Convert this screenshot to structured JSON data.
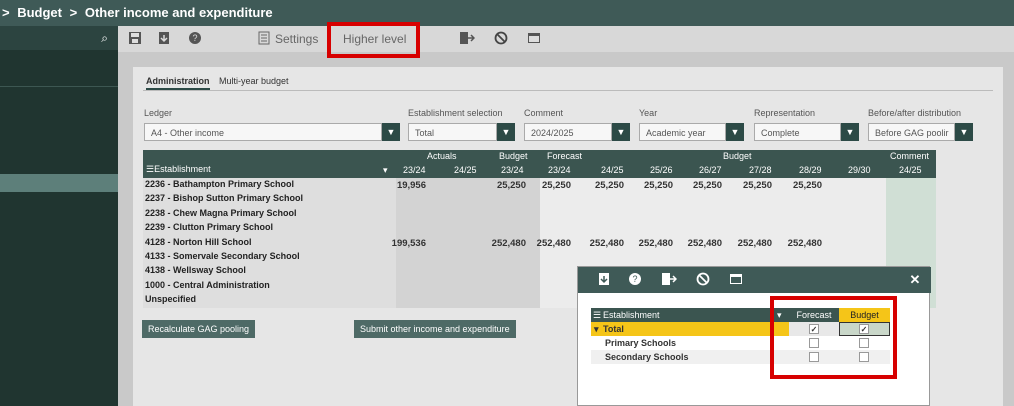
{
  "header": {
    "chevron": ">",
    "crumb1": "Budget",
    "chevron2": ">",
    "crumb2": "Other income and expenditure"
  },
  "sidebar": {
    "search_icon": "search-icon"
  },
  "toolbar": {
    "settings_label": "Settings",
    "higher_level_label": "Higher level"
  },
  "tabs": {
    "administration": "Administration",
    "multiyear": "Multi-year budget"
  },
  "filters": {
    "ledger_label": "Ledger",
    "ledger_value": "A4 - Other income",
    "establishment_label": "Establishment selection",
    "establishment_value": "Total",
    "comment_label": "Comment",
    "comment_value": "2024/2025",
    "year_label": "Year",
    "year_value": "Academic year",
    "representation_label": "Representation",
    "representation_value": "Complete",
    "before_after_label": "Before/after distribution",
    "before_after_value": "Before GAG poolir"
  },
  "table": {
    "establishment_header": "Establishment",
    "groups": {
      "actuals": "Actuals",
      "budget1": "Budget",
      "forecast": "Forecast",
      "budget2": "Budget",
      "comment": "Comment"
    },
    "years": [
      "23/24",
      "24/25",
      "23/24",
      "23/24",
      "24/25",
      "25/26",
      "26/27",
      "27/28",
      "28/29",
      "29/30",
      "24/25"
    ],
    "rows": [
      {
        "name": "2236 - Bathampton Primary School",
        "v": [
          "19,956",
          "",
          "25,250",
          "25,250",
          "25,250",
          "25,250",
          "25,250",
          "25,250",
          "25,250",
          "",
          ""
        ]
      },
      {
        "name": "2237 - Bishop Sutton Primary School",
        "v": [
          "",
          "",
          "",
          "",
          "",
          "",
          "",
          "",
          "",
          "",
          ""
        ]
      },
      {
        "name": "2238 - Chew Magna Primary School",
        "v": [
          "",
          "",
          "",
          "",
          "",
          "",
          "",
          "",
          "",
          "",
          ""
        ]
      },
      {
        "name": "2239 - Clutton Primary School",
        "v": [
          "",
          "",
          "",
          "",
          "",
          "",
          "",
          "",
          "",
          "",
          ""
        ]
      },
      {
        "name": "4128 - Norton Hill School",
        "v": [
          "199,536",
          "",
          "252,480",
          "252,480",
          "252,480",
          "252,480",
          "252,480",
          "252,480",
          "252,480",
          "",
          ""
        ]
      },
      {
        "name": "4133 - Somervale Secondary School",
        "v": [
          "",
          "",
          "",
          "",
          "",
          "",
          "",
          "",
          "",
          "",
          ""
        ]
      },
      {
        "name": "4138 - Wellsway School",
        "v": [
          "",
          "",
          "",
          "",
          "",
          "",
          "",
          "",
          "",
          "",
          ""
        ]
      },
      {
        "name": "1000 - Central Administration",
        "v": [
          "",
          "",
          "",
          "",
          "",
          "",
          "",
          "",
          "",
          "",
          ""
        ]
      },
      {
        "name": "Unspecified",
        "v": [
          "",
          "",
          "",
          "",
          "",
          "",
          "",
          "",
          "",
          "",
          ""
        ]
      }
    ]
  },
  "buttons": {
    "recalc": "Recalculate GAG pooling",
    "submit": "Submit other income and expenditure"
  },
  "dialog": {
    "close": "✕",
    "establishment_header": "Establishment",
    "forecast_header": "Forecast",
    "budget_header": "Budget",
    "rows": [
      {
        "name": "Total",
        "forecast": true,
        "budget": true
      },
      {
        "name": "Primary Schools",
        "forecast": false,
        "budget": false
      },
      {
        "name": "Secondary Schools",
        "forecast": false,
        "budget": false
      }
    ]
  },
  "colors": {
    "header_bg": "#3f5a57",
    "highlight": "#f5c518",
    "red_box": "#d70000"
  }
}
